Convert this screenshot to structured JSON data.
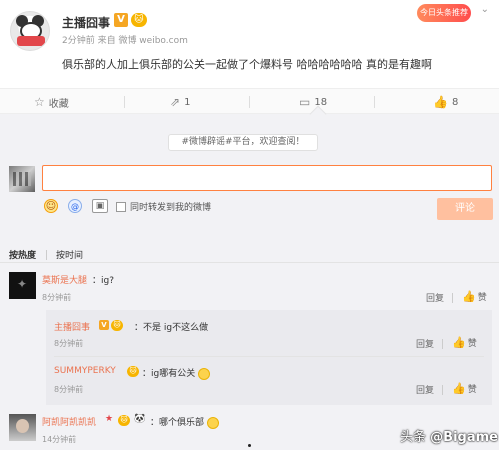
{
  "post": {
    "author": "主播囧事",
    "verified_mark": "V",
    "level_badge": "🐱",
    "meta": "2分钟前 来自 微博 weibo.com",
    "text": "俱乐部的人加上俱乐部的公关一起做了个爆料号 哈哈哈哈哈哈 真的是有趣啊",
    "corner_badge": "今日头条推荐",
    "corner_chevron": "⌄"
  },
  "actions": {
    "favorite": {
      "icon": "☆",
      "label": "收藏"
    },
    "forward": {
      "icon": "⇗",
      "label": "1"
    },
    "comment": {
      "icon": "▭",
      "label": "18"
    },
    "like": {
      "icon": "👍",
      "label": "8"
    }
  },
  "composer": {
    "notice": "#微博辟谣#平台，欢迎查阅！",
    "input_value": "",
    "emoji_icon": "☺",
    "at_icon": "@",
    "image_icon": "▣",
    "sync_label": "同时转发到我的微博",
    "submit_label": "评论"
  },
  "sort": {
    "hot": "按热度",
    "time": "按时间"
  },
  "comments": [
    {
      "name": "莫斯是大腿",
      "text": "：ig?",
      "time": "8分钟前",
      "reply_label": "回复",
      "like_icon": "👍",
      "like_label": "赞",
      "replies": [
        {
          "name": "主播囧事",
          "v": "V",
          "lv": "🐱",
          "text": "：不是 ig不这么做",
          "time": "8分钟前",
          "reply_label": "回复",
          "like_icon": "👍",
          "like_label": "赞"
        },
        {
          "name": "SUMMYPERKY",
          "lv": "🐱",
          "text": "：ig哪有公关",
          "time": "8分钟前",
          "reply_label": "回复",
          "like_icon": "👍",
          "like_label": "赞"
        }
      ]
    },
    {
      "name": "阿凯阿凯凯凯",
      "star": "★",
      "lv": "🐱",
      "panda": "🐼",
      "text": "：哪个俱乐部",
      "time": "14分钟前"
    }
  ],
  "watermark": {
    "prefix": "头条",
    "handle": "@Bigame"
  },
  "colors": {
    "accent": "#ff8140",
    "name": "#eb7350",
    "submit_disabled": "#ffc09f",
    "comment_bg": "#f2f2f5",
    "badge": "#f7b500"
  }
}
